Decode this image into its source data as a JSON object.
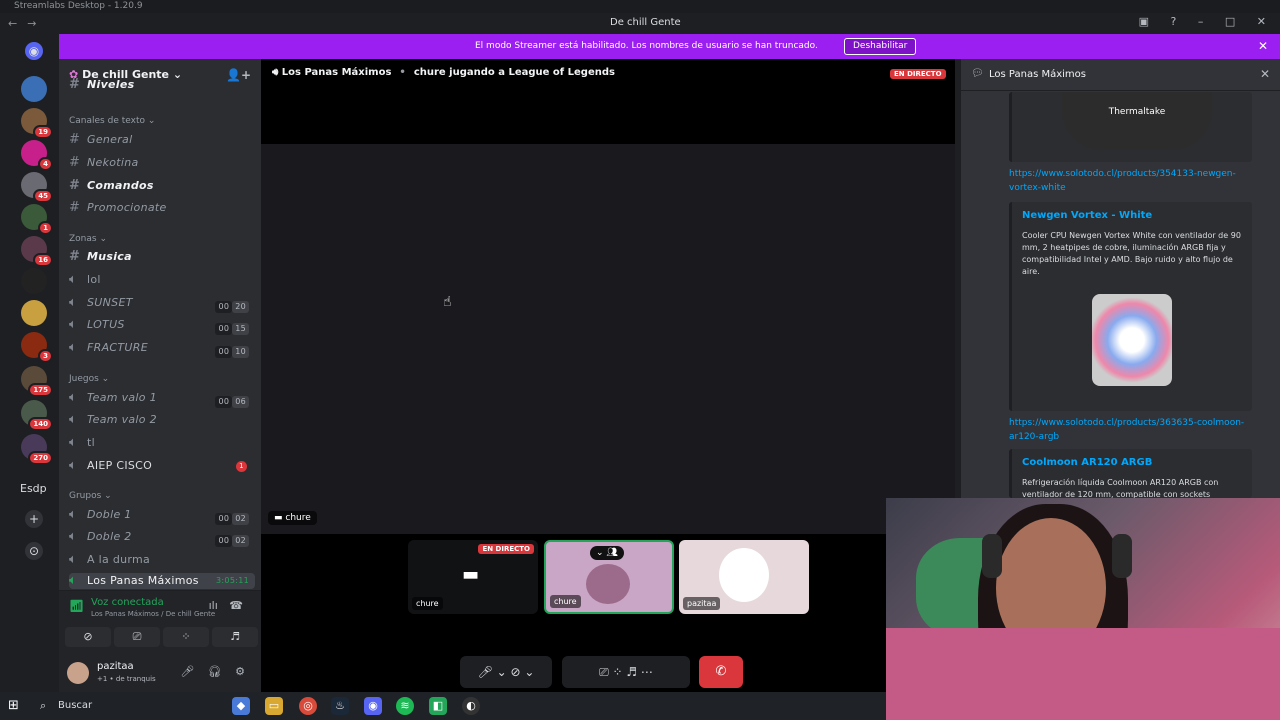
{
  "window": {
    "title": "Streamlabs Desktop - 1.20.9",
    "center_title": "De chill Gente"
  },
  "banner": {
    "text": "El modo Streamer está habilitado. Los nombres de usuario se han truncado.",
    "button": "Deshabilitar"
  },
  "servers": [
    {
      "badge": ""
    },
    {
      "badge": "19"
    },
    {
      "badge": "4"
    },
    {
      "badge": "45"
    },
    {
      "badge": "1"
    },
    {
      "badge": "16"
    },
    {
      "badge": ""
    },
    {
      "badge": ""
    },
    {
      "badge": "3"
    },
    {
      "badge": "175"
    },
    {
      "badge": "140"
    },
    {
      "badge": "270"
    }
  ],
  "server_text": "Esdp",
  "guild": {
    "name": "De chill Gente"
  },
  "channels": {
    "partial": "Niveles",
    "cat_text": "Canales de texto",
    "text": [
      "General",
      "Nekotina",
      "Comandos",
      "Promocionate"
    ],
    "cat_zonas": "Zonas",
    "musica": "Musica",
    "lol": "lol",
    "sunset": {
      "name": "SUNSET",
      "a": "00",
      "b": "20"
    },
    "lotus": {
      "name": "LOTUS",
      "a": "00",
      "b": "15"
    },
    "fracture": {
      "name": "FRACTURE",
      "a": "00",
      "b": "10"
    },
    "cat_juegos": "Juegos",
    "valo1": {
      "name": "Team valo 1",
      "a": "00",
      "b": "06"
    },
    "valo2": "Team valo 2",
    "tl": "tl",
    "aiep": {
      "name": "AIEP CISCO",
      "badge": "1"
    },
    "cat_grupos": "Grupos",
    "doble1": {
      "name": "Doble 1",
      "a": "00",
      "b": "02"
    },
    "doble2": {
      "name": "Doble 2",
      "a": "00",
      "b": "02"
    },
    "durma": "A la durma",
    "panas": {
      "name": "Los Panas Máximos",
      "time": "3:05:11"
    }
  },
  "voice": {
    "status": "Voz conectada",
    "sub": "Los Panas Máximos / De chill Gente"
  },
  "user": {
    "name": "pazitaa",
    "status": "+1 • de tranquis"
  },
  "stage": {
    "channel": "Los Panas Máximos",
    "activity": "chure jugando a League of Legends",
    "live": "EN DIRECTO",
    "chip": "chure"
  },
  "tiles": {
    "t1": {
      "label": "chure",
      "live": "EN DIRECTO"
    },
    "t2": {
      "label": "chure"
    },
    "t3": {
      "label": "pazitaa"
    }
  },
  "right": {
    "title": "Los Panas Máximos",
    "img1": "Thermaltake",
    "link1": "https://www.solotodo.cl/products/354133-newgen-vortex-white",
    "card1": {
      "title": "Newgen Vortex - White",
      "desc": "Cooler CPU Newgen Vortex White con ventilador de 90 mm, 2 heatpipes de cobre, iluminación ARGB fija y compatibilidad Intel y AMD. Bajo ruido y alto flujo de aire."
    },
    "link2": "https://www.solotodo.cl/products/363635-coolmoon-ar120-argb",
    "card2": {
      "title": "Coolmoon AR120 ARGB",
      "desc": "Refrigeración líquida Coolmoon AR120 ARGB con ventilador de 120 mm, compatible con sockets"
    }
  },
  "taskbar": {
    "search": "Buscar"
  }
}
